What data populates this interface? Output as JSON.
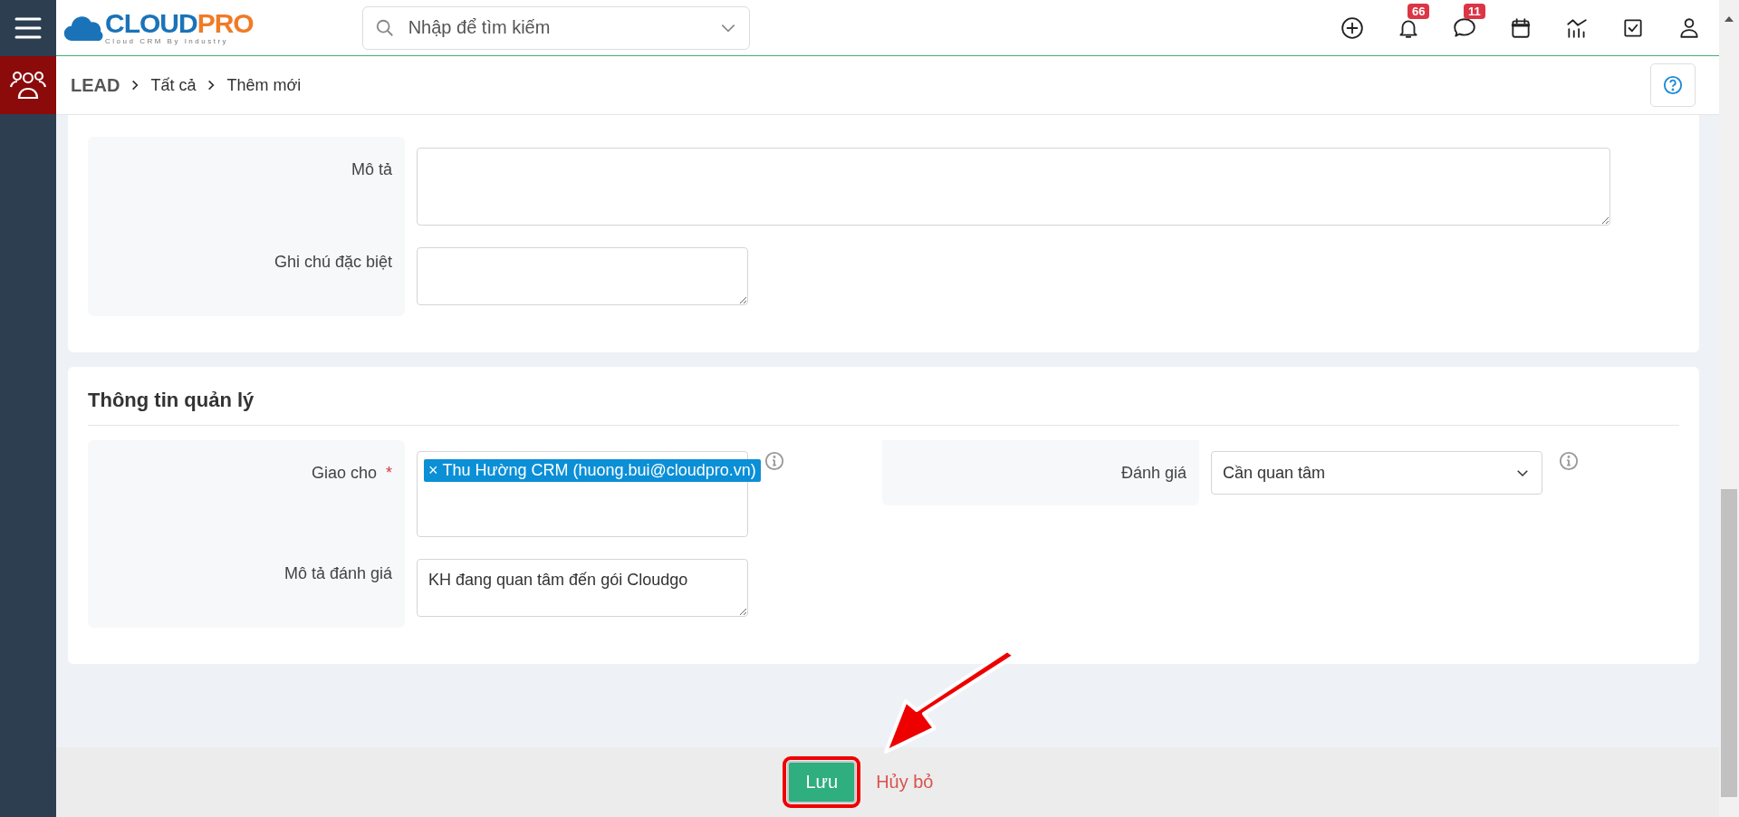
{
  "header": {
    "logo": {
      "part_1": "CLOUD",
      "part_2": "PRO",
      "tagline": "Cloud CRM By Industry"
    },
    "search": {
      "placeholder": "Nhập để tìm kiếm"
    },
    "notification_count": "66",
    "message_count": "11"
  },
  "breadcrumb": [
    "LEAD",
    "Tất cả",
    "Thêm mới"
  ],
  "sections": [
    {
      "columns": [
        [
          {
            "label": "Mô tả",
            "kind": "longtext",
            "info": false
          },
          {
            "label": "Ghi chú đặc biệt",
            "kind": "text",
            "info": false
          }
        ]
      ]
    },
    {
      "title": "Thông tin quản lý",
      "columns": [
        [
          {
            "label": "Giao cho",
            "kind": "tags",
            "required_mark": "*",
            "info": true,
            "tags": [
              {
                "remove": "×",
                "label": "Thu Hường CRM (huong.bui@cloudpro.vn)"
              }
            ]
          },
          {
            "label": "Mô tả đánh giá",
            "kind": "text",
            "info": false,
            "value": "KH đang quan tâm đến gói Cloudgo"
          }
        ],
        [
          {
            "label": "Đánh giá",
            "kind": "select",
            "info": true,
            "value": "Cần quan tâm"
          }
        ]
      ]
    }
  ],
  "footer": {
    "buttons": [
      {
        "label": "Lưu",
        "kind": "primary",
        "highlighted": true
      },
      {
        "label": "Hủy bỏ",
        "kind": "link",
        "highlighted": false
      }
    ]
  }
}
